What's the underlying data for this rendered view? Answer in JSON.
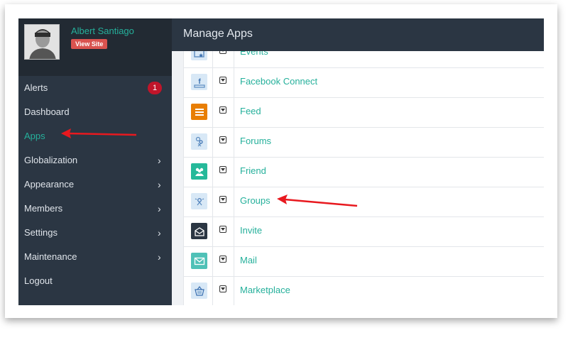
{
  "profile": {
    "name": "Albert Santiago",
    "view_site_label": "View Site"
  },
  "menu": [
    {
      "label": "Alerts",
      "badge": "1"
    },
    {
      "label": "Dashboard"
    },
    {
      "label": "Apps",
      "active": true
    },
    {
      "label": "Globalization",
      "chevron": "›"
    },
    {
      "label": "Appearance",
      "chevron": "›"
    },
    {
      "label": "Members",
      "chevron": "›"
    },
    {
      "label": "Settings",
      "chevron": "›"
    },
    {
      "label": "Maintenance",
      "chevron": "›"
    },
    {
      "label": "Logout"
    }
  ],
  "header": {
    "title": "Manage Apps"
  },
  "apps": [
    {
      "name": "Events",
      "icon": "events-icon"
    },
    {
      "name": "Facebook Connect",
      "icon": "facebook-icon"
    },
    {
      "name": "Feed",
      "icon": "feed-icon"
    },
    {
      "name": "Forums",
      "icon": "forums-icon"
    },
    {
      "name": "Friend",
      "icon": "friend-icon"
    },
    {
      "name": "Groups",
      "icon": "groups-icon"
    },
    {
      "name": "Invite",
      "icon": "invite-icon"
    },
    {
      "name": "Mail",
      "icon": "mail-icon"
    },
    {
      "name": "Marketplace",
      "icon": "marketplace-icon"
    }
  ],
  "colors": {
    "accent": "#25b09b",
    "sidebar": "#2b3643",
    "badge": "#c0152a",
    "annotation_arrow": "#e8191f"
  }
}
